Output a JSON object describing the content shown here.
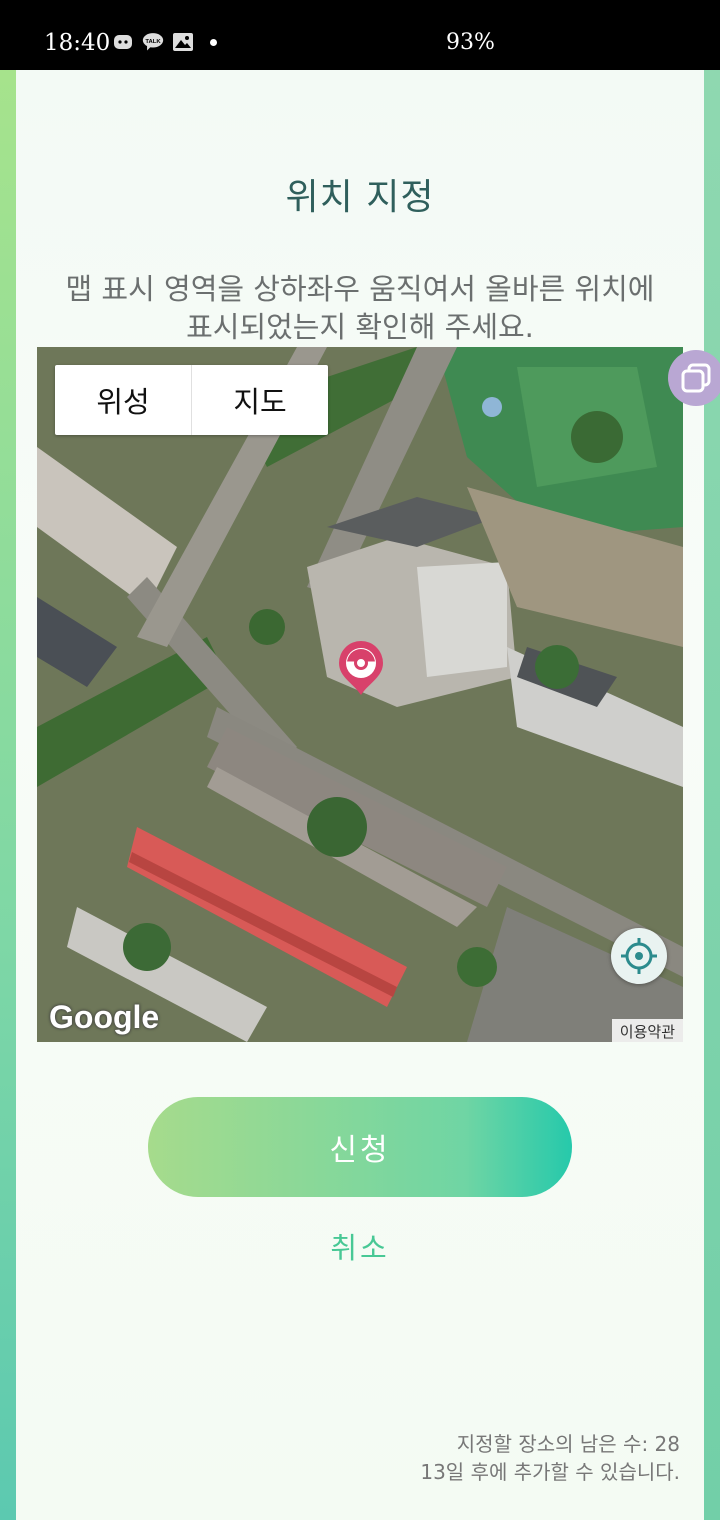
{
  "status_bar": {
    "time": "18:40",
    "battery": "93%",
    "icons": [
      "game-controller-icon",
      "kakaotalk-icon",
      "gallery-icon",
      "notification-dot-icon"
    ],
    "talk_label": "TALK"
  },
  "page": {
    "title": "위치 지정",
    "instruction_line1": "맵 표시 영역을 상하좌우 움직여서 올바른 위치에",
    "instruction_line2": "표시되었는지 확인해 주세요."
  },
  "map": {
    "type_options": [
      "위성",
      "지도"
    ],
    "selected_type": "위성",
    "provider": "Google",
    "terms_label": "이용약관"
  },
  "actions": {
    "submit_label": "신청",
    "cancel_label": "취소"
  },
  "footer": {
    "remaining_text": "지정할 장소의 남은 수: 28",
    "next_text": "13일 후에 추가할 수 있습니다."
  },
  "colors": {
    "title": "#2f5f5c",
    "accent": "#48c895",
    "pin": "#d8416b"
  }
}
